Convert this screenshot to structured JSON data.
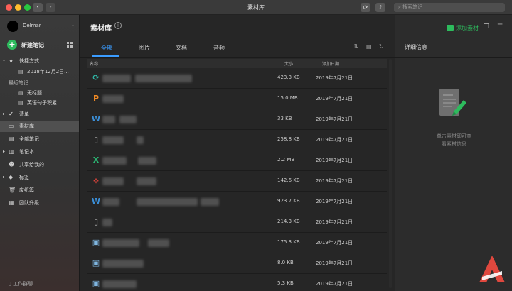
{
  "window": {
    "title": "素材库",
    "search_placeholder": "搜索笔记"
  },
  "sidebar": {
    "user_name": "Delmar",
    "new_note_label": "新建笔记",
    "shortcuts_label": "快捷方式",
    "shortcut_item": "2018年12月2日...",
    "recent_label": "最近笔记",
    "recent_items": [
      "无标题",
      "英语句子积累"
    ],
    "items": [
      {
        "label": "清单",
        "icon": "checklist-icon"
      },
      {
        "label": "素材库",
        "icon": "folder-icon"
      },
      {
        "label": "全部笔记",
        "icon": "notes-icon"
      },
      {
        "label": "笔记本",
        "icon": "notebook-icon"
      },
      {
        "label": "共享给我的",
        "icon": "people-icon"
      },
      {
        "label": "标签",
        "icon": "tag-icon"
      },
      {
        "label": "废纸篓",
        "icon": "trash-icon"
      },
      {
        "label": "团队升级",
        "icon": "team-icon"
      }
    ],
    "footer_label": "工作群聊"
  },
  "main": {
    "title": "素材库",
    "tabs": [
      "全部",
      "图片",
      "文档",
      "音频"
    ],
    "active_tab": "全部",
    "columns": {
      "name": "名称",
      "size": "大小",
      "date": "添加日期"
    },
    "rows": [
      {
        "icon": "sync-file-icon",
        "icon_char": "⟳",
        "color": "#2fb8a8",
        "size": "423.3 KB",
        "date": "2019年7月21日"
      },
      {
        "icon": "ppt-file-icon",
        "icon_char": "P",
        "color": "#f08a24",
        "size": "15.0 MB",
        "date": "2019年7月21日"
      },
      {
        "icon": "word-file-icon",
        "icon_char": "W",
        "color": "#3b8ed6",
        "size": "33 KB",
        "date": "2019年7月21日"
      },
      {
        "icon": "generic-file-icon",
        "icon_char": "▯",
        "color": "#d6d6d6",
        "size": "258.8 KB",
        "date": "2019年7月21日"
      },
      {
        "icon": "excel-file-icon",
        "icon_char": "X",
        "color": "#2bb673",
        "size": "2.2 MB",
        "date": "2019年7月21日"
      },
      {
        "icon": "pdf-file-icon",
        "icon_char": "⟡",
        "color": "#e8463d",
        "size": "142.6 KB",
        "date": "2019年7月21日"
      },
      {
        "icon": "word-file-icon",
        "icon_char": "W",
        "color": "#3b8ed6",
        "size": "923.7 KB",
        "date": "2019年7月21日"
      },
      {
        "icon": "generic-file-icon",
        "icon_char": "▯",
        "color": "#d6d6d6",
        "size": "214.3 KB",
        "date": "2019年7月21日"
      },
      {
        "icon": "image-file-icon",
        "icon_char": "▣",
        "color": "#7fb6e0",
        "size": "175.3 KB",
        "date": "2019年7月21日"
      },
      {
        "icon": "image-file-icon",
        "icon_char": "▣",
        "color": "#7fb6e0",
        "size": "8.0 KB",
        "date": "2019年7月21日"
      },
      {
        "icon": "image-file-icon",
        "icon_char": "▣",
        "color": "#7fb6e0",
        "size": "5.3 KB",
        "date": "2019年7月21日"
      }
    ]
  },
  "right_panel": {
    "add_label": "添加素材",
    "detail_title": "详细信息",
    "hint_line1": "单击素材即可查",
    "hint_line2": "看素材信息"
  },
  "colors": {
    "accent_blue": "#3b9cff",
    "accent_green": "#2dbb5d",
    "brand_red": "#e0483e"
  }
}
